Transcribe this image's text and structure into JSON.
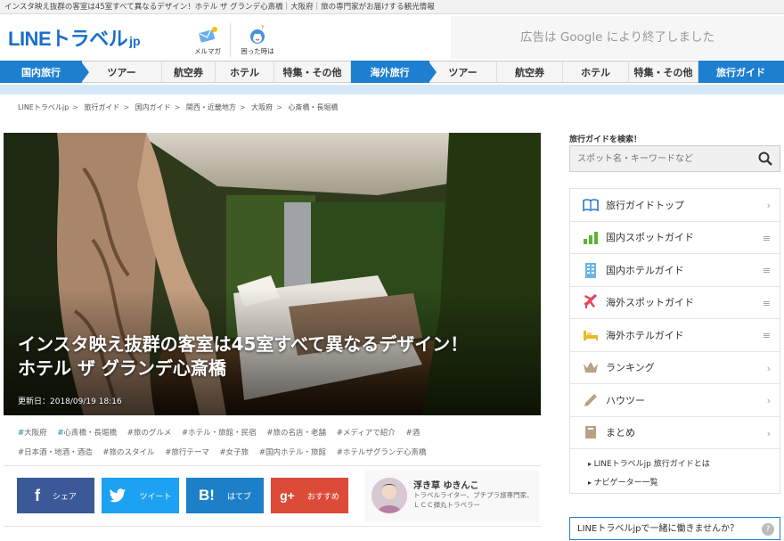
{
  "topbar": {
    "text": "インスタ映え抜群の客室は45室すべて異なるデザイン！ホテル ザ グランデ心斎橋｜大阪府｜旅の専門家がお届けする観光情報"
  },
  "header": {
    "logo_main": "LINEトラベル",
    "logo_suffix": "jp",
    "mailmag_label": "メルマガ",
    "help_label": "困った時は",
    "ad_text": "広告は Google により終了しました"
  },
  "nav": {
    "items": [
      {
        "label": "国内旅行",
        "style": "blue-arrow"
      },
      {
        "label": "ツアー"
      },
      {
        "label": "航空券"
      },
      {
        "label": "ホテル"
      },
      {
        "label": "特集・その他"
      },
      {
        "label": "海外旅行",
        "style": "blue-arrow"
      },
      {
        "label": "ツアー"
      },
      {
        "label": "航空券"
      },
      {
        "label": "ホテル"
      },
      {
        "label": "特集・その他"
      },
      {
        "label": "旅行ガイド",
        "style": "blue"
      }
    ]
  },
  "breadcrumb": [
    "LINEトラベルjp",
    "旅行ガイド",
    "国内ガイド",
    "関西・近畿地方",
    "大阪府",
    "心斎橋・長堀橋"
  ],
  "article": {
    "title_line1": "インスタ映え抜群の客室は45室すべて異なるデザイン！",
    "title_line2": "ホテル ザ グランデ心斎橋",
    "updated": "更新日：2018/09/19 18:16"
  },
  "tags": [
    {
      "label": "大阪府",
      "bold": true
    },
    {
      "label": "心斎橋・長堀橋",
      "bold": true
    },
    {
      "label": "旅のグルメ"
    },
    {
      "label": "ホテル・旅館・民宿"
    },
    {
      "label": "旅の名店・老舗"
    },
    {
      "label": "メディアで紹介"
    },
    {
      "label": "酒"
    },
    {
      "label": "日本酒・地酒・酒造"
    },
    {
      "label": "旅のスタイル"
    },
    {
      "label": "旅行テーマ"
    },
    {
      "label": "女子旅"
    },
    {
      "label": "国内ホテル・旅館"
    },
    {
      "label": "ホテルザグランデ心斎橋"
    }
  ],
  "share": {
    "facebook": {
      "icon": "f",
      "label": "シェア",
      "color": "#3b5998"
    },
    "twitter": {
      "label": "ツイート",
      "color": "#1da1f2"
    },
    "hatena": {
      "icon": "B!",
      "label": "はてブ",
      "color": "#1d7fc7"
    },
    "google": {
      "icon": "g+",
      "label": "おすすめ",
      "color": "#dc4a38"
    }
  },
  "author": {
    "name": "浮き草 ゆきんこ",
    "desc": "トラベルライター、プチプラ旅専門家、ＬＣＣ弾丸トラベラー"
  },
  "sidebar": {
    "search_label": "旅行ガイドを検索！",
    "search_placeholder": "スポット名・キーワードなど",
    "items": [
      {
        "label": "旅行ガイドトップ",
        "icon": "book-icon",
        "chev": "›"
      },
      {
        "label": "国内スポットガイド",
        "icon": "chart-icon",
        "chev": "≡"
      },
      {
        "label": "国内ホテルガイド",
        "icon": "building-icon",
        "chev": "≡"
      },
      {
        "label": "海外スポットガイド",
        "icon": "airplane-icon",
        "chev": "≡"
      },
      {
        "label": "海外ホテルガイド",
        "icon": "bed-icon",
        "chev": "≡"
      },
      {
        "label": "ランキング",
        "icon": "crown-icon",
        "chev": "›"
      },
      {
        "label": "ハウツー",
        "icon": "pencil-icon",
        "chev": "›"
      },
      {
        "label": "まとめ",
        "icon": "bookmark-icon",
        "chev": "›"
      }
    ],
    "sub_links": [
      "LINEトラベルjp 旅行ガイドとは",
      "ナビゲーター一覧"
    ],
    "join_text": "LINEトラベルjpで一緒に働きませんか？",
    "join_icon": "?"
  },
  "colors": {
    "brand_blue": "#1e7fd1",
    "tag_accent": "#3ea7b8"
  }
}
